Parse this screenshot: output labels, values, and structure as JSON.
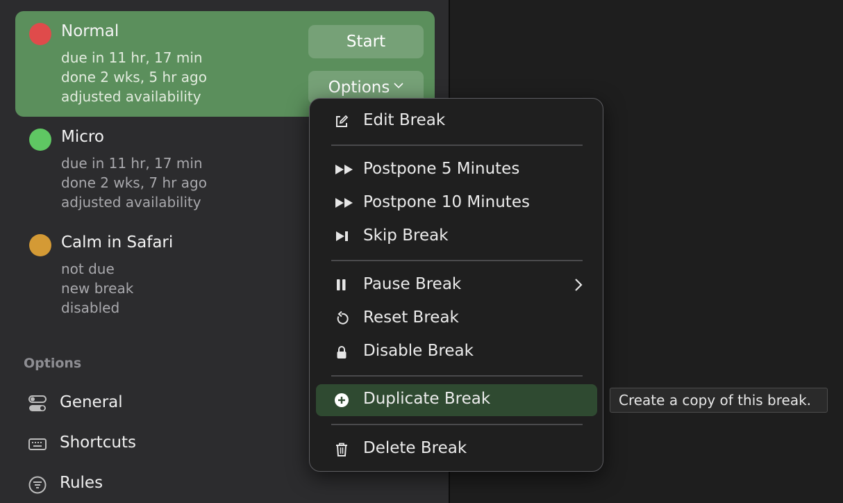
{
  "breaks": [
    {
      "name": "Normal",
      "dot_color": "#df4b4b",
      "lines": [
        "due in 11 hr, 17 min",
        "done 2 wks, 5 hr ago",
        "adjusted availability"
      ],
      "selected": true
    },
    {
      "name": "Micro",
      "dot_color": "#5fc763",
      "lines": [
        "due in 11 hr, 17 min",
        "done 2 wks, 7 hr ago",
        "adjusted availability"
      ],
      "selected": false
    },
    {
      "name": "Calm in Safari",
      "dot_color": "#d49a35",
      "lines": [
        "not due",
        "new break",
        "disabled"
      ],
      "selected": false
    }
  ],
  "buttons": {
    "start": "Start",
    "options": "Options"
  },
  "options_section": {
    "header": "Options",
    "items": [
      {
        "label": "General",
        "icon": "toggles-icon"
      },
      {
        "label": "Shortcuts",
        "icon": "keyboard-icon"
      },
      {
        "label": "Rules",
        "icon": "rules-icon"
      }
    ]
  },
  "menu": {
    "items": [
      {
        "label": "Edit Break",
        "icon": "edit-icon"
      },
      {
        "label": "Postpone 5 Minutes",
        "icon": "fast-forward-icon"
      },
      {
        "label": "Postpone 10 Minutes",
        "icon": "fast-forward-icon"
      },
      {
        "label": "Skip Break",
        "icon": "skip-icon"
      },
      {
        "label": "Pause Break",
        "icon": "pause-icon",
        "submenu": true
      },
      {
        "label": "Reset Break",
        "icon": "reset-icon"
      },
      {
        "label": "Disable Break",
        "icon": "lock-icon"
      },
      {
        "label": "Duplicate Break",
        "icon": "plus-circle-icon",
        "highlighted": true
      },
      {
        "label": "Delete Break",
        "icon": "trash-icon"
      }
    ]
  },
  "tooltip": "Create a copy of this break.",
  "colors": {
    "selected_row": "#5b8f5c",
    "menu_highlight": "#2f4a31"
  }
}
